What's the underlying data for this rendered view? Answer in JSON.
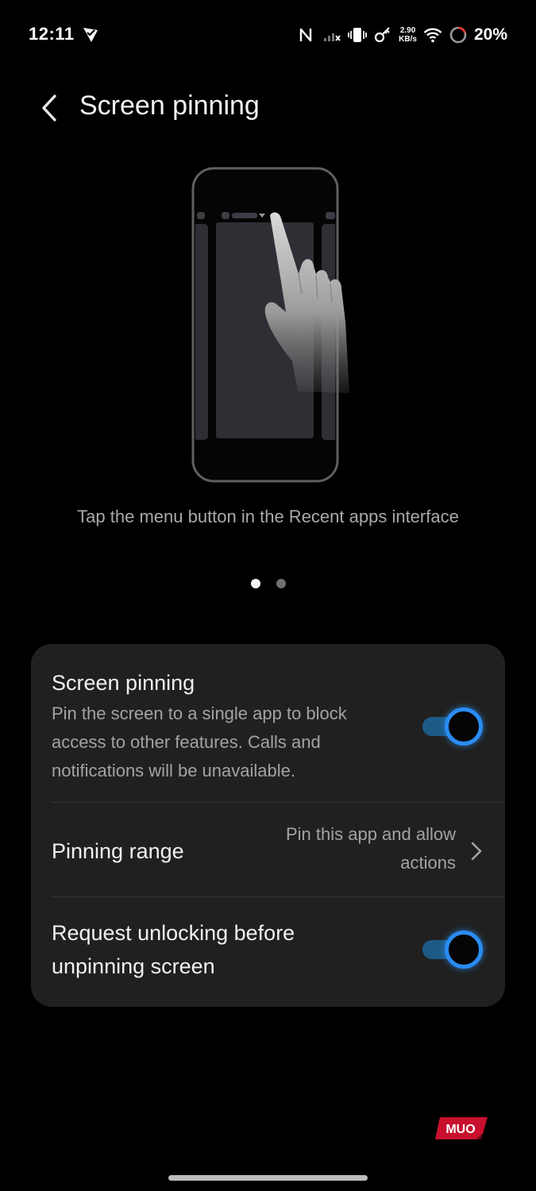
{
  "status_bar": {
    "time": "12:11",
    "speed_value": "2.90",
    "speed_unit": "KB/s",
    "battery": "20%",
    "icons": [
      "location-check-icon",
      "nfc-icon",
      "signal-off-icon",
      "vibrate-icon",
      "vpn-key-icon",
      "wifi-icon",
      "battery-ring-icon"
    ]
  },
  "header": {
    "title": "Screen pinning",
    "back_icon": "chevron-left-icon"
  },
  "illustration": {
    "caption": "Tap the menu button in the Recent apps interface",
    "page_count": 2,
    "active_page": 1
  },
  "settings": {
    "screen_pinning": {
      "title": "Screen pinning",
      "description": "Pin the screen to a single app to block access to other features. Calls and notifications will be unavailable.",
      "enabled": true
    },
    "pinning_range": {
      "title": "Pinning range",
      "value": "Pin this app and allow actions"
    },
    "request_unlock": {
      "title": "Request unlocking before unpinning screen",
      "enabled": true
    }
  },
  "colors": {
    "accent": "#2a8cf2",
    "card_background": "#202020",
    "secondary_text": "#a3a3a3"
  },
  "watermark": "MUO"
}
